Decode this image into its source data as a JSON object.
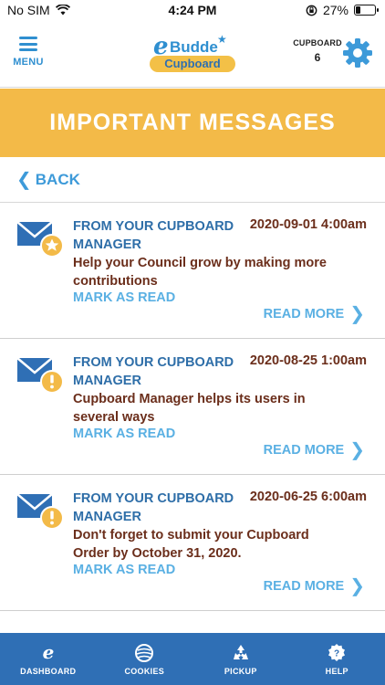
{
  "status_bar": {
    "carrier": "No SIM",
    "time": "4:24 PM",
    "battery": "27%",
    "battery_level": 0.27
  },
  "header": {
    "menu_label": "MENU",
    "logo": {
      "e": "e",
      "budde": "Budde",
      "cupboard": "Cupboard"
    },
    "cupboard_label": "CUPBOARD",
    "cupboard_count": "6"
  },
  "banner": {
    "title": "IMPORTANT MESSAGES"
  },
  "back": {
    "label": "BACK"
  },
  "messages": [
    {
      "from": "FROM YOUR CUPBOARD MANAGER",
      "date": "2020-09-01  4:00am",
      "subject": "Help your Council grow by making more contributions",
      "mark_label": "MARK AS READ",
      "more_label": "READ MORE"
    },
    {
      "from": "FROM YOUR CUPBOARD MANAGER",
      "date": "2020-08-25  1:00am",
      "subject": "Cupboard Manager helps its users in several ways",
      "mark_label": "MARK AS READ",
      "more_label": "READ MORE"
    },
    {
      "from": "FROM YOUR CUPBOARD MANAGER",
      "date": "2020-06-25  6:00am",
      "subject": "Don't forget to submit your Cupboard Order by October 31, 2020.",
      "mark_label": "MARK AS READ",
      "more_label": "READ MORE"
    }
  ],
  "bottom_nav": [
    {
      "label": "DASHBOARD",
      "icon": "ebudde-e-icon"
    },
    {
      "label": "COOKIES",
      "icon": "cookie-icon"
    },
    {
      "label": "PICKUP",
      "icon": "recycle-icon"
    },
    {
      "label": "HELP",
      "icon": "help-badge-icon"
    }
  ],
  "colors": {
    "accent_blue": "#2f8fd0",
    "banner_yellow": "#f3ba48",
    "link_blue": "#5ab0e3",
    "text_brown": "#6b2e1b",
    "nav_blue": "#2f6fb5"
  }
}
